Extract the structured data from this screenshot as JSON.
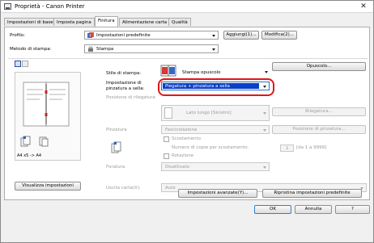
{
  "window": {
    "title": "Proprietà - Canon Printer",
    "close_symbol": "✕"
  },
  "tabs": [
    {
      "label": "Impostazioni di base"
    },
    {
      "label": "Imposta pagina"
    },
    {
      "label": "Finitura"
    },
    {
      "label": "Alimentazione carta"
    },
    {
      "label": "Qualità"
    }
  ],
  "profile": {
    "label": "Profilo:",
    "value": "Impostazioni predefinite",
    "add_button": "Aggiungi(1)...",
    "edit_button": "Modifica(2)..."
  },
  "output_method": {
    "label": "Metodo di stampa:",
    "value": "Stampa"
  },
  "preview": {
    "caption": "A4 x5 -> A4",
    "view_settings_button": "Visualizza impostazioni"
  },
  "print_style": {
    "label": "Stile di stampa:",
    "value": "Stampa opuscolo",
    "options_button": "Opuscolo..."
  },
  "stitch": {
    "label_line1": "Impostazione di",
    "label_line2": "pinzatura a sella:",
    "value": "Piegatura + pinzatura a sella"
  },
  "binding_location": {
    "label": "Posizione di rilegatura",
    "value": "Lato lungo [Sinistro]",
    "button": "Rilegatura..."
  },
  "finishing": {
    "label": "Pinzatura",
    "value": "Fascicolazione",
    "staple_button": "Posizione di pinzatura..."
  },
  "offset": {
    "checkbox_label": "Scostamento",
    "copies_label": "Numero di copie per scostamento:",
    "copies_value": "1",
    "copies_range": "[da 1 a 9999]"
  },
  "rotate": {
    "checkbox_label": "Rotazione"
  },
  "fold": {
    "label": "Foratura",
    "value": "Disattivato"
  },
  "output_tray": {
    "label": "Uscita carta(X):",
    "value": "Auto"
  },
  "bottom_buttons": {
    "advanced": "Impostazioni avanzate(Y)...",
    "restore": "Ripristina impostazioni predefinite",
    "ok": "OK",
    "cancel": "Annulla",
    "help": "?"
  },
  "colors": {
    "selection": "#0a3fc8",
    "annotation": "#e0161a"
  }
}
